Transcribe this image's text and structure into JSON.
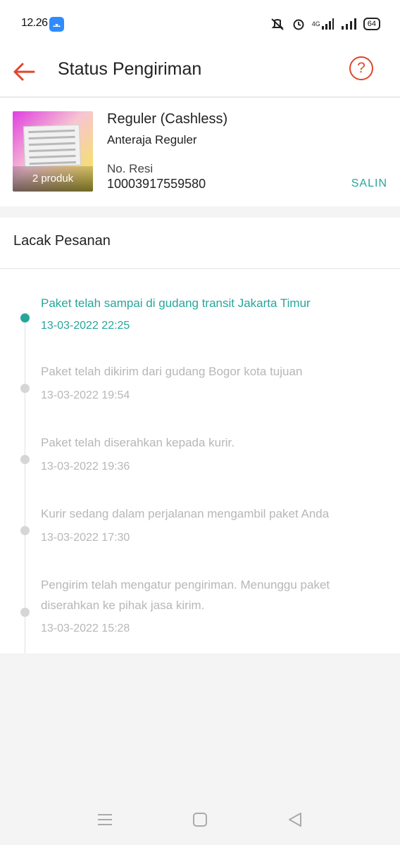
{
  "status_bar": {
    "time": "12.26",
    "network_type": "4G",
    "battery": "64",
    "icons": [
      "app-notification-icon",
      "mute-icon",
      "alarm-icon",
      "signal-icon",
      "signal-icon",
      "battery-icon"
    ]
  },
  "header": {
    "title": "Status Pengiriman",
    "back_icon": "arrow-left-icon",
    "help_icon": "question-circle-icon",
    "help_symbol": "?",
    "accent_color": "#e0452d"
  },
  "shipment": {
    "product_badge": "2 produk",
    "service": "Reguler (Cashless)",
    "courier": "Anteraja Reguler",
    "resi_label": "No. Resi",
    "resi_number": "10003917559580",
    "copy_label": "SALIN",
    "copy_color": "#26a69a"
  },
  "tracking": {
    "title": "Lacak Pesanan",
    "active_color": "#26a69a",
    "events": [
      {
        "text": "Paket telah sampai di gudang transit Jakarta Timur",
        "time": "13-03-2022 22:25",
        "active": true
      },
      {
        "text": "Paket telah dikirim dari gudang Bogor kota tujuan",
        "time": "13-03-2022 19:54",
        "active": false
      },
      {
        "text": "Paket telah diserahkan kepada kurir.",
        "time": "13-03-2022 19:36",
        "active": false
      },
      {
        "text": "Kurir sedang dalam perjalanan mengambil paket Anda",
        "time": "13-03-2022 17:30",
        "active": false
      },
      {
        "text": "Pengirim telah mengatur pengiriman. Menunggu paket diserahkan ke pihak jasa kirim.",
        "time": "13-03-2022 15:28",
        "active": false
      }
    ]
  },
  "nav_bar": {
    "buttons": [
      "menu-icon",
      "home-square-icon",
      "back-triangle-icon"
    ]
  }
}
